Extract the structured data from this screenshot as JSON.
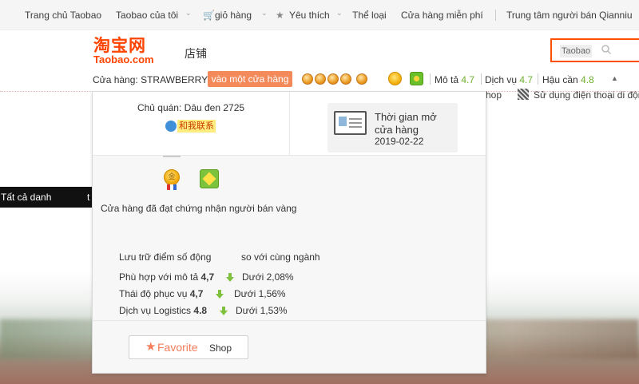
{
  "topnav": {
    "home": "Trang chủ Taobao",
    "my_taobao": "Taobao của tôi",
    "cart": "giỏ hàng",
    "favorites": "Yêu thích",
    "category": "Thể loại",
    "free_store": "Cửa hàng miễn phí",
    "seller_center": "Trung tâm người bán Qianniu"
  },
  "header": {
    "logo_cn": "淘宝网",
    "logo_en": "Taobao.com",
    "store_word": "店铺",
    "search_value": "Taobao"
  },
  "store_bar": {
    "store_label": "Cửa hàng: STRAWBERRY",
    "enter_button": "vào một cửa hàng",
    "ratings": [
      {
        "label": "Mô tả",
        "value": "4.7"
      },
      {
        "label": "Dịch vụ",
        "value": "4.7"
      },
      {
        "label": "Hậu cần",
        "value": "4.8"
      }
    ]
  },
  "behind": {
    "right_text_1": "hop",
    "right_text_2": "Sử dụng điện thoại di động",
    "category_label": "Tất cả danh",
    "category_tail": "t"
  },
  "popup": {
    "owner": "Chủ quán: Dâu đen 2725",
    "contact": "和我联系",
    "open_label": "Thời gian mở cửa hàng",
    "open_date": "2019-02-22",
    "gold_badge_char": "金",
    "cert_text": "Cửa hàng đã đạt chứng nhận người bán vàng",
    "dsr_title": "Lưu trữ điểm số động",
    "dsr_compare_title": "so với cùng ngành",
    "dsr": [
      {
        "label": "Phù hợp với mô tả",
        "value": "4,7",
        "compare": "Dưới 2,08%"
      },
      {
        "label": "Thái độ phục vụ",
        "value": "4,7",
        "compare": "Dưới 1,56%"
      },
      {
        "label": "Dịch vụ Logistics",
        "value": "4.8",
        "compare": "Dưới 1,53%"
      }
    ],
    "favorite_label": "Favorite",
    "shop_label": "Shop"
  },
  "colors": {
    "accent": "#ff5000",
    "green": "#6fb02f",
    "favorite": "#f47d5a"
  }
}
